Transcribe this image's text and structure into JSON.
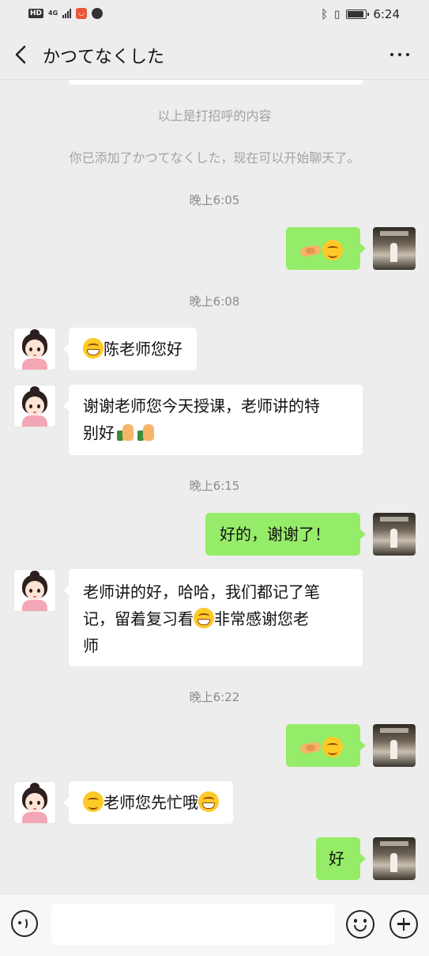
{
  "status_bar": {
    "hd": "HD",
    "network": "4G",
    "time": "6:24",
    "icons": [
      "hd-icon",
      "signal-icon",
      "app-notification-icon",
      "location-icon",
      "bluetooth-icon",
      "vibrate-icon",
      "battery-icon"
    ],
    "battery_level": 0.8
  },
  "header": {
    "title": "かつてなくした",
    "back_icon": "chevron-left-icon",
    "more_icon": "more-dots-icon"
  },
  "chat": {
    "system_greeting_note": "以上是打招呼的内容",
    "system_added_note": "你已添加了かつてなくした，现在可以开始聊天了。",
    "timestamps": [
      "晚上6:05",
      "晚上6:08",
      "晚上6:15",
      "晚上6:22"
    ],
    "messages": [
      {
        "side": "right",
        "emojis": [
          "handshake",
          "smile"
        ]
      },
      {
        "side": "left",
        "prefix_emoji": "grin",
        "text": "陈老师您好"
      },
      {
        "side": "left",
        "line1": "谢谢老师您今天授课，老师讲的特",
        "line2": "别好",
        "suffix_emojis": [
          "thumbs-up",
          "thumbs-up"
        ]
      },
      {
        "side": "right",
        "text": "好的，谢谢了！"
      },
      {
        "side": "left",
        "line1": "老师讲的好，哈哈，我们都记了笔",
        "line2_a": "记，留着复习看",
        "line2_b": "非常感谢您老",
        "line3": "师"
      },
      {
        "side": "right",
        "emojis": [
          "handshake",
          "smile"
        ]
      },
      {
        "side": "left",
        "text": "老师您先忙哦"
      },
      {
        "side": "right",
        "text": "好"
      }
    ]
  },
  "input_bar": {
    "voice_icon": "voice-icon",
    "emoji_icon": "emoji-icon",
    "plus_icon": "plus-icon",
    "input_value": ""
  },
  "colors": {
    "background": "#ededed",
    "sent_bubble": "#95ec69",
    "received_bubble": "#ffffff",
    "system_text": "#a3a3a3"
  }
}
